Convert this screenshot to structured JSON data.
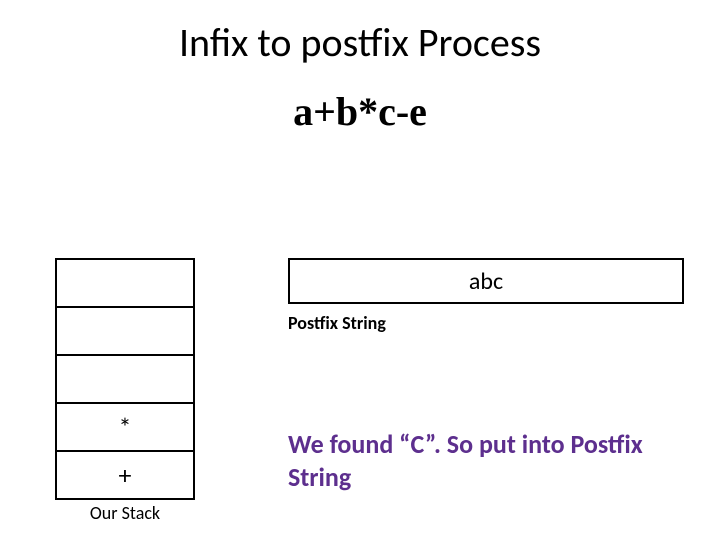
{
  "title": "Infix to postfix Process",
  "expression": "a+b*c-e",
  "stack": {
    "cells": [
      "",
      "",
      "",
      "*",
      "+"
    ],
    "label": "Our Stack"
  },
  "postfix": {
    "value": "abc",
    "label": "Postfix String"
  },
  "explanation": "We found “C”. So put into Postfix String"
}
